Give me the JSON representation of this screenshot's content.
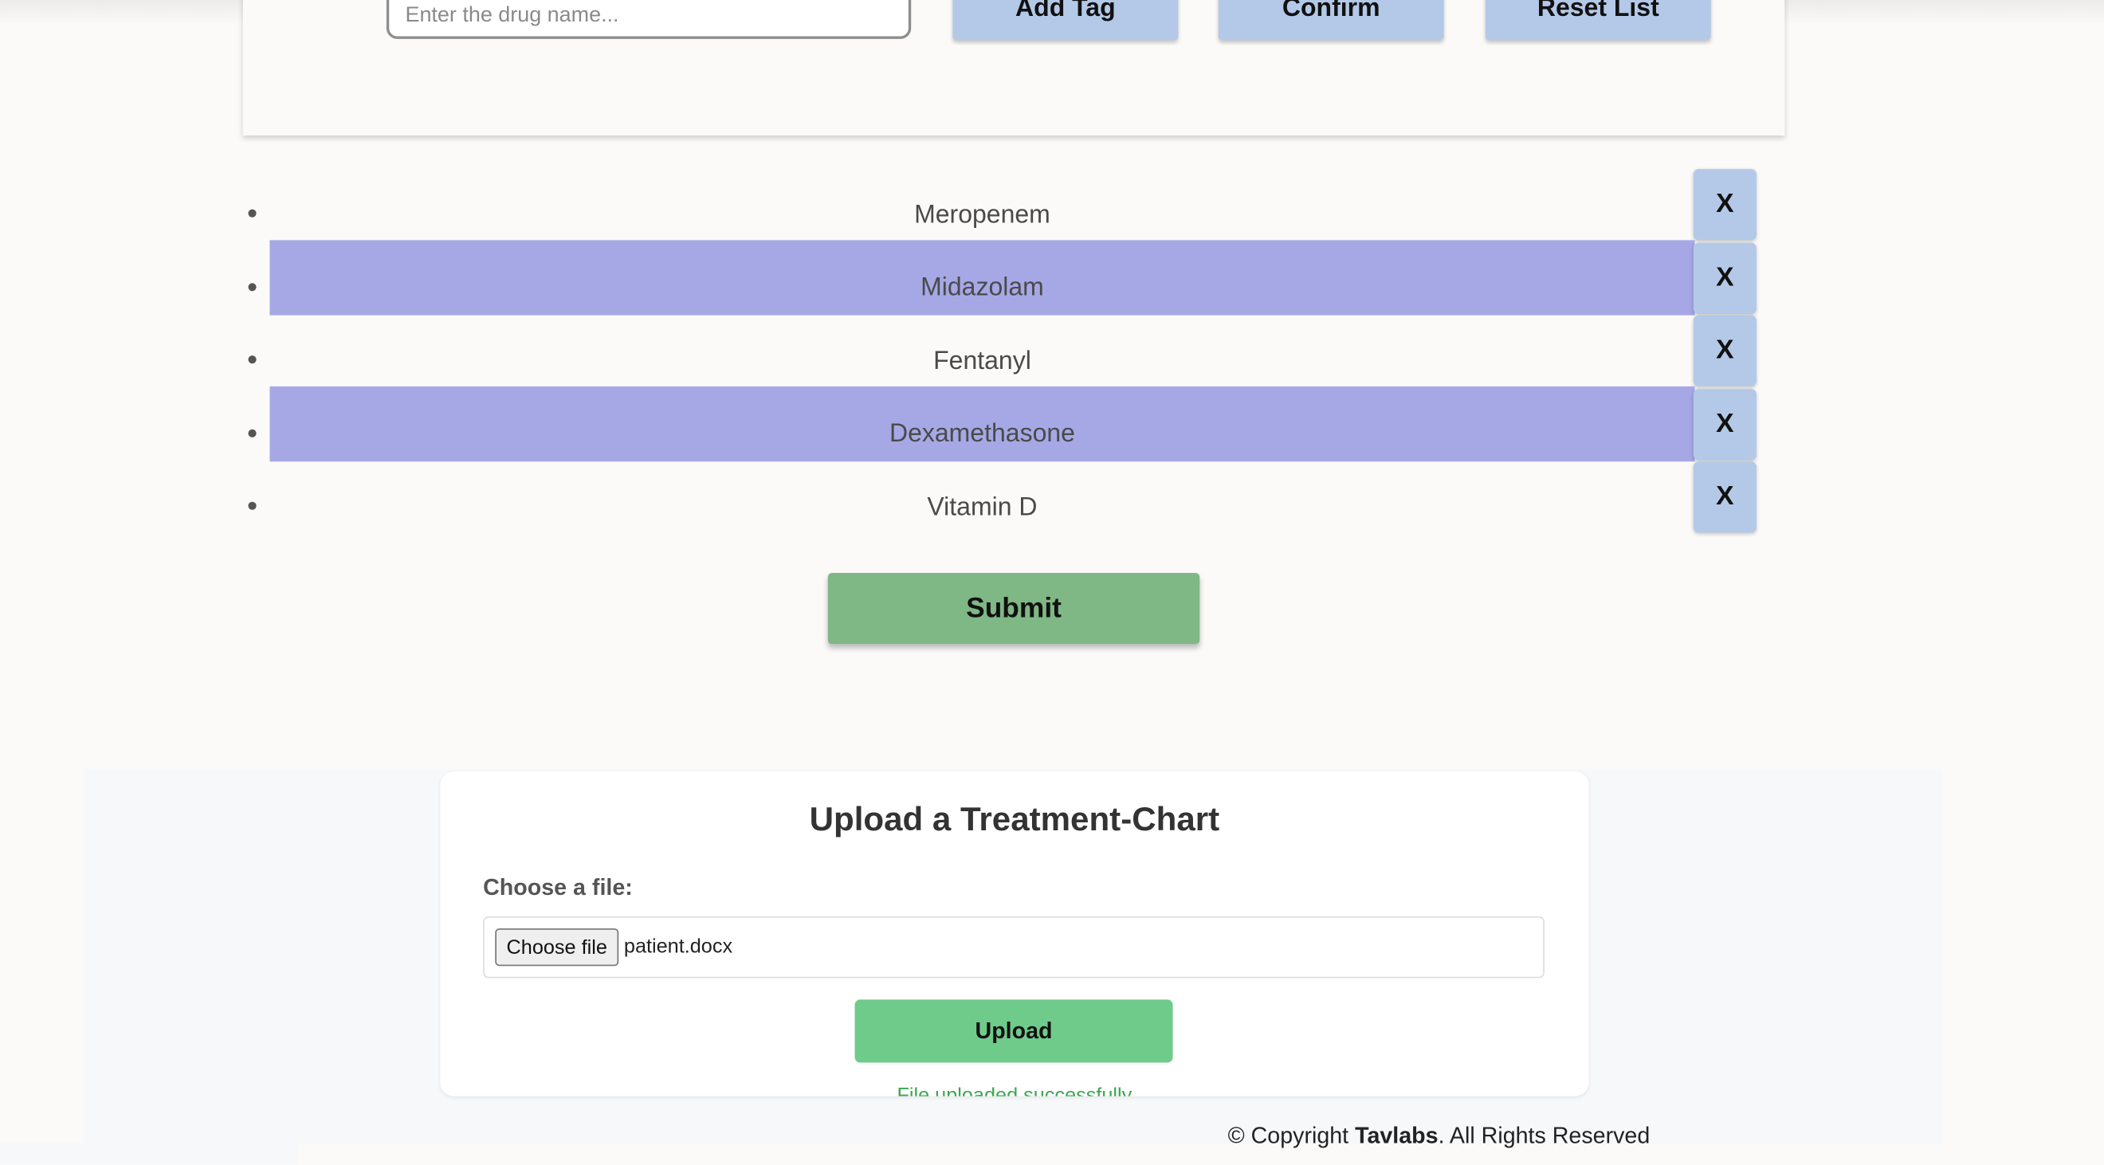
{
  "drug_form": {
    "input_placeholder": "Enter the drug name...",
    "add_tag_label": "Add Tag",
    "confirm_label": "Confirm",
    "reset_label": "Reset List"
  },
  "drug_list": {
    "items": [
      {
        "name": "Meropenem",
        "remove_label": "X"
      },
      {
        "name": "Midazolam",
        "remove_label": "X"
      },
      {
        "name": "Fentanyl",
        "remove_label": "X"
      },
      {
        "name": "Dexamethasone",
        "remove_label": "X"
      },
      {
        "name": "Vitamin D",
        "remove_label": "X"
      }
    ],
    "highlight_color": "#a6a8e6"
  },
  "submit_label": "Submit",
  "upload": {
    "title": "Upload a Treatment-Chart",
    "file_label": "Choose a file:",
    "choose_button": "Choose file",
    "file_name": "patient.docx",
    "upload_button": "Upload",
    "message": "File uploaded successfully"
  },
  "footer": {
    "prefix": "© Copyright ",
    "brand": "Tavlabs",
    "suffix": ". All Rights Reserved"
  },
  "colors": {
    "tag_button": "#b4c9e8",
    "submit_button": "#7fb785",
    "upload_button": "#6fcb8a",
    "success_text": "#3aa651"
  }
}
